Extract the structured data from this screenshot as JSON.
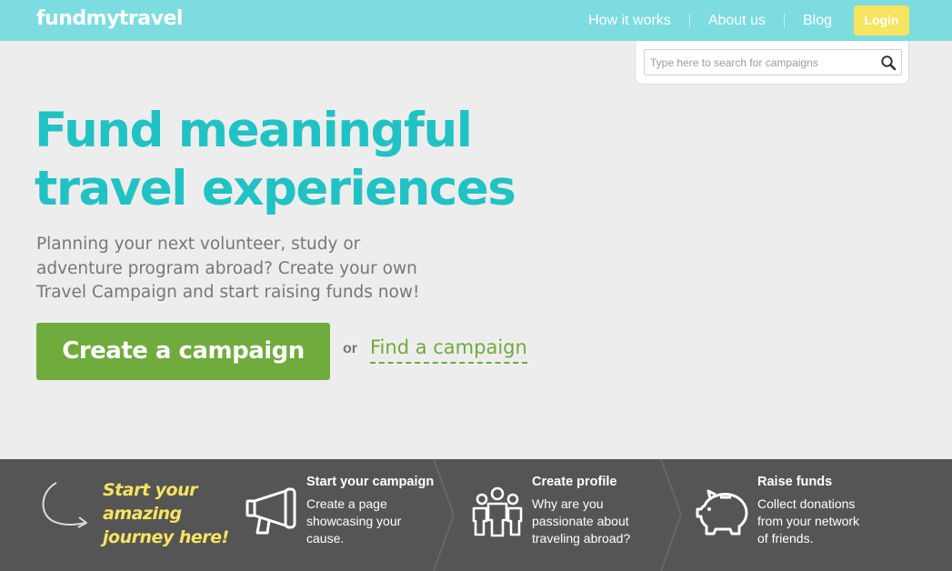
{
  "brand": {
    "logo": "fundmytravel"
  },
  "nav": {
    "how_it_works": "How it works",
    "about_us": "About us",
    "blog": "Blog",
    "login": "Login"
  },
  "search": {
    "placeholder": "Type here to search for campaigns"
  },
  "hero": {
    "headline_line1": "Fund meaningful",
    "headline_line2": "travel experiences",
    "sub_line1": "Planning your next volunteer, study or",
    "sub_line2": "adventure program abroad? Create your own",
    "sub_line3": "Travel Campaign and start raising funds now!",
    "primary_cta": "Create a campaign",
    "or": "or",
    "secondary_cta": "Find a campaign"
  },
  "steps_strip": {
    "tagline_line1": "Start your",
    "tagline_line2": "amazing",
    "tagline_line3": "journey here!",
    "steps": [
      {
        "icon": "megaphone-icon",
        "title": "Start your campaign",
        "desc_line1": "Create a page",
        "desc_line2": "showcasing your",
        "desc_line3": "cause."
      },
      {
        "icon": "people-icon",
        "title": "Create profile",
        "desc_line1": "Why are you",
        "desc_line2": "passionate about",
        "desc_line3": "traveling abroad?"
      },
      {
        "icon": "piggy-bank-icon",
        "title": "Raise funds",
        "desc_line1": "Collect donations",
        "desc_line2": "from your network",
        "desc_line3": "of friends."
      }
    ]
  },
  "colors": {
    "header": "#7cdcdf",
    "headline": "#21c2c4",
    "cta_green": "#6fab3d",
    "login_yellow": "#f7e460",
    "strip": "#555555"
  }
}
